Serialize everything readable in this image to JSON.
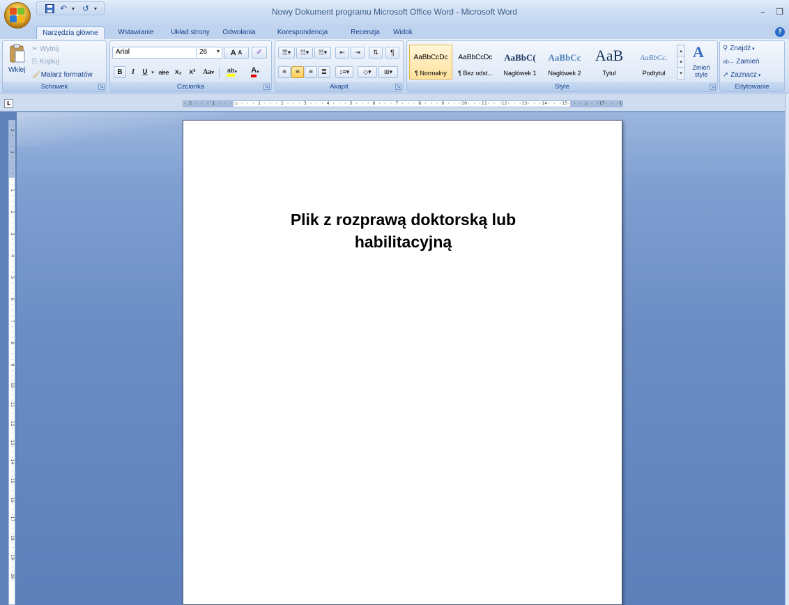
{
  "window": {
    "title": "Nowy Dokument programu Microsoft Office Word - Microsoft Word"
  },
  "tabs": [
    "Narzędzia główne",
    "Wstawianie",
    "Układ strony",
    "Odwołania",
    "Korespondencja",
    "Recenzja",
    "Widok"
  ],
  "active_tab": "Narzędzia główne",
  "clipboard": {
    "label": "Schowek",
    "paste": "Wklej",
    "cut": "Wytnij",
    "copy": "Kopiuj",
    "format_painter": "Malarz formatów"
  },
  "font": {
    "label": "Czcionka",
    "name": "Arial",
    "size": "26",
    "bold": "B",
    "italic": "I",
    "underline": "U",
    "strike": "abe",
    "subscript": "x₂",
    "superscript": "x²",
    "change_case": "Aa",
    "grow": "A",
    "shrink": "A",
    "highlight": "ab",
    "color": "A"
  },
  "paragraph": {
    "label": "Akapit"
  },
  "styles": {
    "label": "Style",
    "items": [
      {
        "sample": "AaBbCcDc",
        "name": "¶ Normalny"
      },
      {
        "sample": "AaBbCcDc",
        "name": "¶ Bez odst..."
      },
      {
        "sample": "AaBbC(",
        "name": "Nagłówek 1"
      },
      {
        "sample": "AaBbCc",
        "name": "Nagłówek 2"
      },
      {
        "sample": "AaB",
        "name": "Tytuł"
      },
      {
        "sample": "AaBbCc.",
        "name": "Podtytuł"
      }
    ],
    "change_styles": "Zmień style"
  },
  "editing": {
    "label": "Edytowanie",
    "find": "Znajdź",
    "replace": "Zamień",
    "select": "Zaznacz"
  },
  "ruler": {
    "horizontal": "· 2 · · · 1 · · · ⌂ · · · 1 · · · 2 · · · 3 · · · 4 · · · 5 · · · 6 · · · 7 · · · 8 · · · 9 · · ·10· · ·11· · ·12· · ·13· · ·14· · ·15· · · ⌂ · ·17· · ·18·",
    "vertical": "· 2 · · · 1 · · · · · · 1 · · · 2 · · · 3 · · · 4 · · · 5 · · · 6 · · · 7 · · · 8 · · · 9 · · ·10· · ·11· · ·12· · ·13· · ·14· · ·15· · ·16· · ·17· · ·18· · ·19· · ·20·",
    "tab_selector": "L"
  },
  "document": {
    "title_line1": "Plik z rozprawą doktorską lub",
    "title_line2": "habilitacyjną"
  },
  "colors": {
    "accent": "#15428b",
    "workspace": "#6b8dc4",
    "selected_style": "#ffe29c"
  }
}
